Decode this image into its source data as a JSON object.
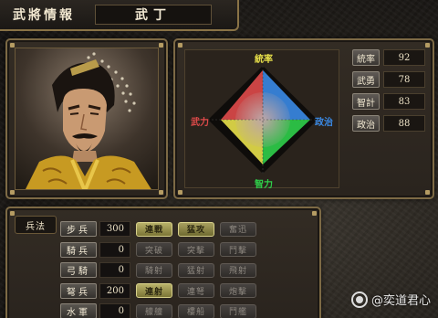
{
  "header": {
    "title": "武將情報",
    "officer_name": "武丁"
  },
  "stats": {
    "axis_top": "統率",
    "axis_bottom": "智力",
    "axis_left": "武力",
    "axis_right": "政治",
    "colors": {
      "top": "#e8e04a",
      "bottom": "#2fcf4a",
      "left": "#e04a4a",
      "right": "#3a8ae6"
    },
    "items": [
      {
        "label": "統率",
        "value": "92",
        "level": 0.92
      },
      {
        "label": "武勇",
        "value": "78",
        "level": 0.78
      },
      {
        "label": "智計",
        "value": "83",
        "level": 0.83
      },
      {
        "label": "政治",
        "value": "88",
        "level": 0.88
      }
    ]
  },
  "troops": {
    "title": "兵法",
    "rows": [
      {
        "name": "步兵",
        "count": "300",
        "tactics": [
          {
            "label": "連戰",
            "active": true
          },
          {
            "label": "猛攻",
            "active": true
          },
          {
            "label": "奮迅",
            "active": false
          }
        ]
      },
      {
        "name": "騎兵",
        "count": "0",
        "tactics": [
          {
            "label": "突破",
            "active": false
          },
          {
            "label": "突擊",
            "active": false
          },
          {
            "label": "鬥擊",
            "active": false
          }
        ]
      },
      {
        "name": "弓騎",
        "count": "0",
        "tactics": [
          {
            "label": "騎射",
            "active": false
          },
          {
            "label": "猛射",
            "active": false
          },
          {
            "label": "飛射",
            "active": false
          }
        ]
      },
      {
        "name": "弩兵",
        "count": "200",
        "tactics": [
          {
            "label": "連射",
            "active": true
          },
          {
            "label": "連弩",
            "active": false
          },
          {
            "label": "炮擊",
            "active": false
          }
        ]
      },
      {
        "name": "水軍",
        "count": "0",
        "tactics": [
          {
            "label": "艨艟",
            "active": false
          },
          {
            "label": "樓船",
            "active": false
          },
          {
            "label": "鬥艦",
            "active": false
          }
        ]
      }
    ]
  },
  "watermark": {
    "text": "@奕道君心"
  }
}
